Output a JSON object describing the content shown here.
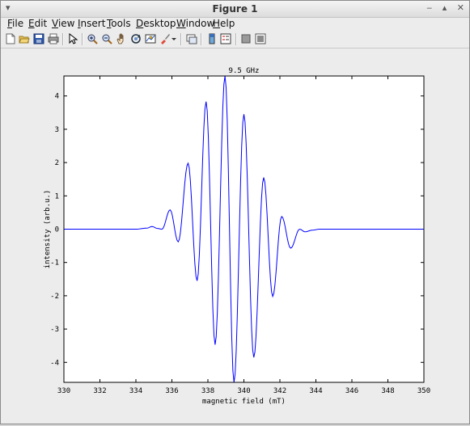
{
  "window": {
    "title": "Figure 1",
    "left_glyph": "▾",
    "controls": [
      "‒",
      "▴",
      "✕"
    ]
  },
  "menu": [
    {
      "label": "File",
      "mnemonic": "F",
      "rest": "ile"
    },
    {
      "label": "Edit",
      "mnemonic": "E",
      "rest": "dit"
    },
    {
      "label": "View",
      "mnemonic": "V",
      "rest": "iew"
    },
    {
      "label": "Insert",
      "mnemonic": "I",
      "rest": "nsert"
    },
    {
      "label": "Tools",
      "mnemonic": "T",
      "rest": "ools"
    },
    {
      "label": "Desktop",
      "mnemonic": "D",
      "rest": "esktop"
    },
    {
      "label": "Window",
      "mnemonic": "W",
      "rest": "indow"
    },
    {
      "label": "Help",
      "mnemonic": "H",
      "rest": "elp"
    }
  ],
  "toolbar_icons": [
    "new-figure-icon",
    "open-file-icon",
    "save-icon",
    "print-icon",
    "edit-plot-arrow-icon",
    "zoom-in-icon",
    "zoom-out-icon",
    "pan-hand-icon",
    "rotate-3d-icon",
    "data-cursor-icon",
    "brush-icon",
    "brush-dropdown-icon",
    "link-plot-icon",
    "colorbar-icon",
    "legend-icon",
    "hide-plot-tools-icon",
    "show-plot-tools-icon"
  ],
  "chart_data": {
    "type": "line",
    "title": "9.5 GHz",
    "xlabel": "magnetic field (mT)",
    "ylabel": "intensity (arb.u.)",
    "xlim": [
      330,
      350
    ],
    "ylim": [
      -4.6,
      4.6
    ],
    "xticks": [
      "330",
      "332",
      "334",
      "336",
      "338",
      "340",
      "342",
      "344",
      "346",
      "348",
      "350"
    ],
    "yticks": [
      "4",
      "3",
      "2",
      "1",
      "0",
      "-1",
      "-2",
      "-3",
      "-4"
    ],
    "grid": false,
    "series": [
      {
        "color": "#0000ff",
        "x": [
          330,
          334,
          334.6,
          334.9,
          335.2,
          335.45,
          335.9,
          336.35,
          336.9,
          337.4,
          337.9,
          338.4,
          338.95,
          339.45,
          340.0,
          340.55,
          341.1,
          341.6,
          342.1,
          342.6,
          343.1,
          343.4,
          343.8,
          344.2,
          350
        ],
        "y": [
          0,
          0,
          0.03,
          0.08,
          0.02,
          0.0,
          0.58,
          -0.38,
          1.98,
          -1.55,
          3.83,
          -3.47,
          4.6,
          -4.6,
          3.45,
          -3.85,
          1.55,
          -2.02,
          0.38,
          -0.57,
          0.0,
          -0.08,
          -0.03,
          0.0,
          0
        ]
      }
    ]
  }
}
